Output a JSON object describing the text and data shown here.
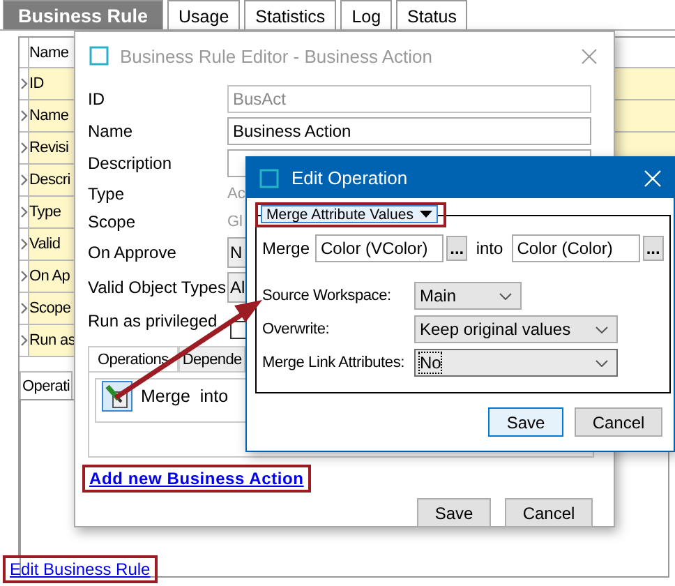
{
  "tabs": [
    {
      "label": "Business Rule",
      "selected": true
    },
    {
      "label": "Usage",
      "selected": false
    },
    {
      "label": "Statistics",
      "selected": false
    },
    {
      "label": "Log",
      "selected": false
    },
    {
      "label": "Status",
      "selected": false
    }
  ],
  "properties_table": {
    "header": "Name",
    "rows": [
      "ID",
      "Name",
      "Revisi",
      "Descri",
      "Type",
      "Valid",
      "On Ap",
      "Scope",
      "Run as"
    ]
  },
  "lower_tabs": [
    {
      "label": "Operati",
      "selected": true
    }
  ],
  "edit_link": "Edit Business Rule",
  "editor": {
    "title": "Business Rule Editor - Business Action",
    "fields": [
      {
        "label": "ID",
        "kind": "input",
        "value": "BusAct",
        "disabled": true
      },
      {
        "label": "Name",
        "kind": "input",
        "value": "Business Action",
        "disabled": false
      },
      {
        "label": "Description",
        "kind": "input",
        "disabled": false
      },
      {
        "label": "Type",
        "kind": "text",
        "value": "Ac"
      },
      {
        "label": "Scope",
        "kind": "text",
        "value": "Gl"
      },
      {
        "label": "On Approve",
        "kind": "dropdown",
        "value": "N"
      },
      {
        "label": "Valid Object Types",
        "kind": "dropdown",
        "value": "Al"
      },
      {
        "label": "Run as privileged",
        "kind": "checkbox",
        "checked": false
      }
    ],
    "tabs": [
      {
        "label": "Operations",
        "selected": true
      },
      {
        "label": "Depende",
        "selected": false
      }
    ],
    "operations": [
      {
        "label": "Merge  into"
      }
    ],
    "add_link": "Add new Business Action",
    "buttons": [
      "Save",
      "Cancel"
    ]
  },
  "edit_operation": {
    "title": "Edit Operation",
    "operation_type": "Merge Attribute Values",
    "merge": {
      "label": "Merge",
      "source": "Color (VColor)",
      "source_browse": "...",
      "into_label": "into",
      "target": "Color (Color)",
      "target_browse": "..."
    },
    "options": [
      {
        "label": "Source Workspace:",
        "value": "Main",
        "focused": false
      },
      {
        "label": "Overwrite:",
        "value": "Keep original values",
        "focused": false
      },
      {
        "label": "Merge Link Attributes:",
        "value": "No",
        "focused": true
      }
    ],
    "buttons": [
      {
        "label": "Save",
        "default": true
      },
      {
        "label": "Cancel",
        "default": false
      }
    ]
  }
}
